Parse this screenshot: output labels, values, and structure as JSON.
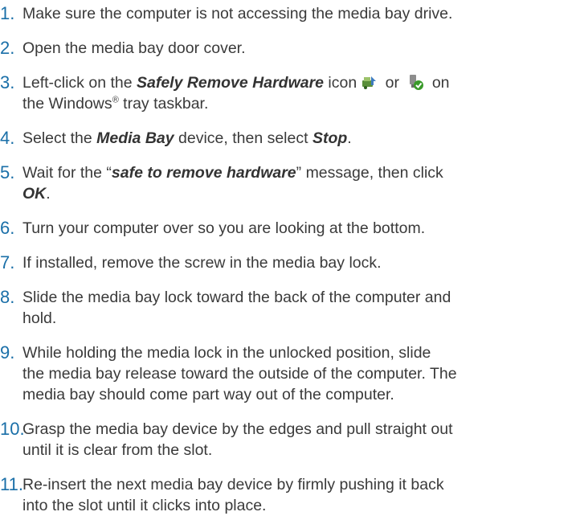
{
  "steps": [
    {
      "number": "1.",
      "text": "Make sure the computer is not accessing the media bay drive."
    },
    {
      "number": "2.",
      "text": "Open the media bay door cover."
    },
    {
      "number": "3.",
      "text_before": "Left-click on the ",
      "emphasis": "Safely Remove Hardware",
      "text_mid": " icon",
      "text_or": " or ",
      "text_on": " on",
      "line2_before": "the Windows",
      "registered": "®",
      "line2_after": " tray taskbar.",
      "icons": [
        "safely-remove-hardware-icon",
        "usb-plug-check-icon"
      ]
    },
    {
      "number": "4.",
      "text_before": "Select the ",
      "emphasis1": "Media Bay",
      "text_mid": " device, then select ",
      "emphasis2": "Stop",
      "text_after": "."
    },
    {
      "number": "5.",
      "text_before": "Wait for the “",
      "emphasis1": "safe to remove hardware",
      "text_mid": "” message, then click",
      "emphasis2": "OK",
      "text_after": "."
    },
    {
      "number": "6.",
      "text": "Turn your computer over so you are looking at the bottom."
    },
    {
      "number": "7.",
      "text": "If installed, remove the screw in the media bay lock."
    },
    {
      "number": "8.",
      "line1": "Slide the media bay lock toward the back of the computer and",
      "line2": "hold."
    },
    {
      "number": "9.",
      "line1": "While holding the media lock in the unlocked position, slide",
      "line2": "the media bay release toward the outside of the computer. The",
      "line3": "media bay should come part way out of the computer."
    },
    {
      "number": "10.",
      "line1": "Grasp the media bay device by the edges and pull straight out",
      "line2": "until it is clear from the slot."
    },
    {
      "number": "11.",
      "line1": "Re-insert the next media bay device by firmly pushing it back",
      "line2": "into the slot until it clicks into place."
    }
  ],
  "colors": {
    "number": "#1a6fa8",
    "text": "#3a3a3a"
  }
}
